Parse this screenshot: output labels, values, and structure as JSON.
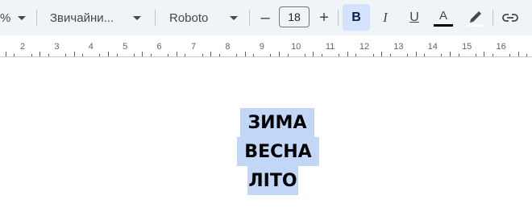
{
  "toolbar": {
    "zoom_fragment": "%",
    "style_label": "Звичайни...",
    "font_label": "Roboto",
    "font_size": "18",
    "minus_symbol": "–",
    "plus_symbol": "+",
    "bold_label": "B",
    "italic_label": "I",
    "underline_label": "U",
    "text_color_label": "A",
    "icons": [
      "dropdown-caret-icon",
      "minus-icon",
      "plus-icon",
      "italic-icon",
      "underline-icon",
      "text-color-icon",
      "highlighter-icon",
      "link-icon"
    ]
  },
  "ruler": {
    "numbers": [
      "2",
      "3",
      "4",
      "5",
      "6",
      "7",
      "8",
      "9",
      "10",
      "11",
      "12",
      "13",
      "14",
      "15",
      "16"
    ]
  },
  "document": {
    "lines": [
      "ЗИМА",
      "ВЕСНА",
      "ЛІТО"
    ],
    "selection_color": "#c2d7f7"
  }
}
